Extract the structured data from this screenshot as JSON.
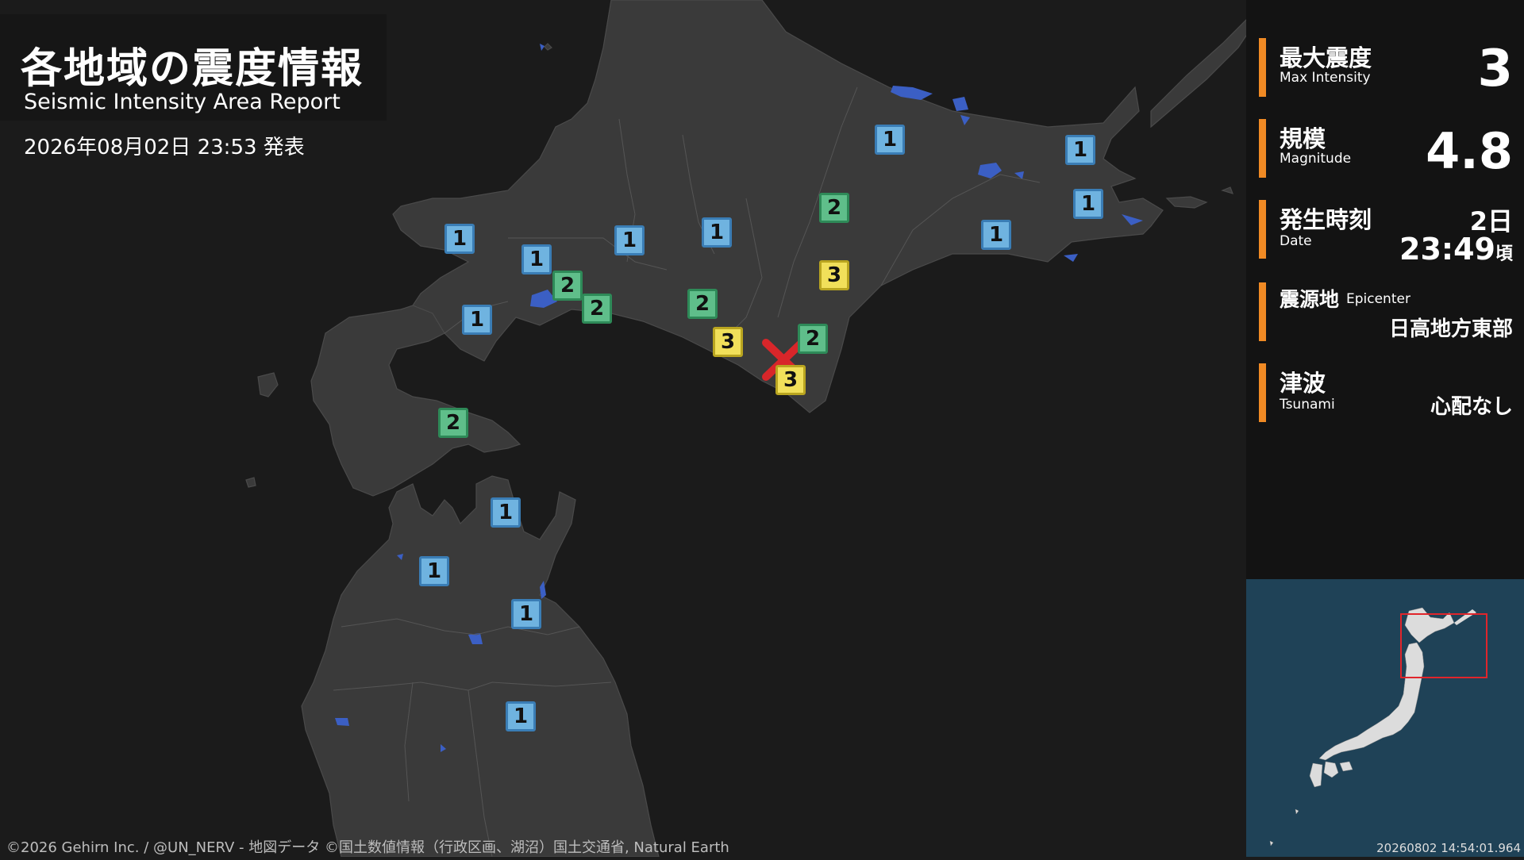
{
  "title": {
    "main": "各地域の震度情報",
    "sub": "Seismic Intensity Area Report",
    "issued": "2026年08月02日 23:53 発表"
  },
  "info": {
    "max_intensity": {
      "label_ja": "最大震度",
      "label_en": "Max Intensity",
      "value": "3"
    },
    "magnitude": {
      "label_ja": "規模",
      "label_en": "Magnitude",
      "value": "4.8"
    },
    "date": {
      "label_ja": "発生時刻",
      "label_en": "Date",
      "day": "2日",
      "time": "23:49",
      "suffix": "頃"
    },
    "epicenter": {
      "label_ja": "震源地",
      "label_en": "Epicenter",
      "value": "日高地方東部"
    },
    "tsunami": {
      "label_ja": "津波",
      "label_en": "Tsunami",
      "value": "心配なし"
    }
  },
  "colors": {
    "accent": "#f08a24",
    "land": "#3a3a3a",
    "water_bg": "#1b1b1b",
    "lake": "#3b5fc4",
    "int1": "#6fb3e0",
    "int2": "#5fbe8a",
    "int3": "#f1e05a",
    "epicenter": "#d8262a",
    "inset_sea": "#1f4257",
    "inset_box": "#e0252b"
  },
  "intensity_markers": [
    "1",
    "1",
    "1",
    "1",
    "1",
    "1",
    "1",
    "1",
    "1",
    "1",
    "1",
    "1",
    "1",
    "2",
    "2",
    "2",
    "2",
    "2",
    "2",
    "3",
    "3",
    "3"
  ],
  "epicenter_marker": {
    "icon": "x-mark-icon",
    "intensity": "3"
  },
  "inset": {
    "timestamp": "20260802 14:54:01.964"
  },
  "credit": "©2026 Gehirn Inc. / @UN_NERV - 地図データ ©国土数値情報（行政区画、湖沼）国土交通省, Natural Earth"
}
